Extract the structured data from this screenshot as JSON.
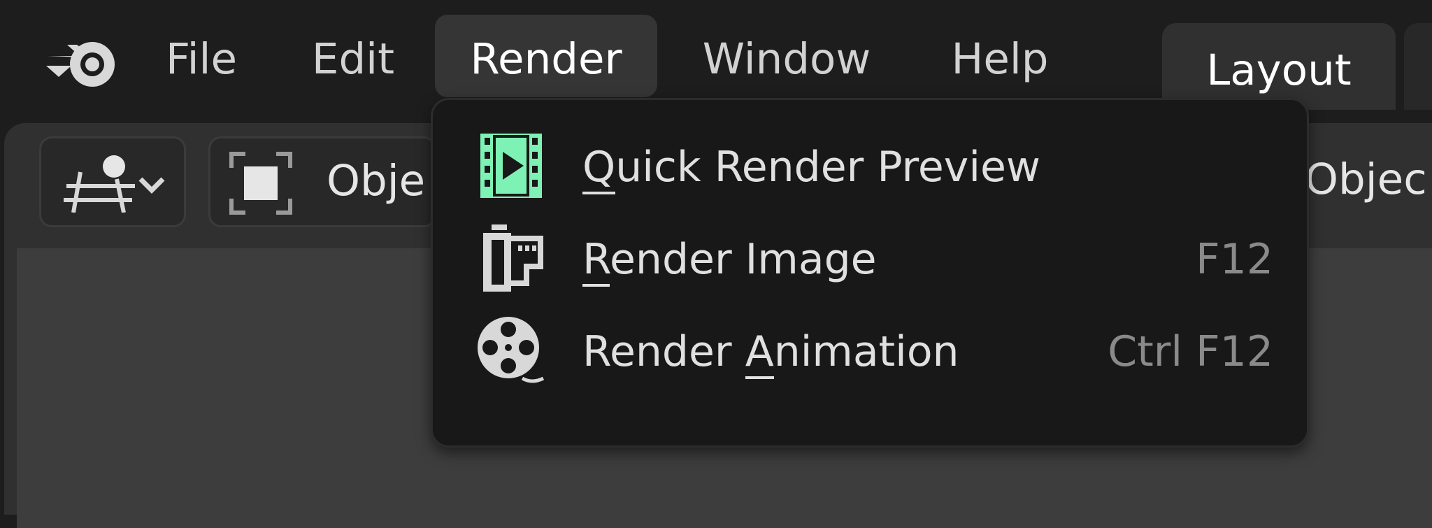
{
  "menu": {
    "logo_icon": "blender-logo-icon",
    "items": [
      {
        "label": "File"
      },
      {
        "label": "Edit"
      },
      {
        "label": "Render",
        "active": true
      },
      {
        "label": "Window"
      },
      {
        "label": "Help"
      }
    ]
  },
  "workspace_tabs": [
    {
      "label": "Layout"
    }
  ],
  "header": {
    "editor_type_icon": "scene-editor-icon",
    "mode_icon": "object-mode-icon",
    "mode_label": "Obje",
    "right_label": "Objec"
  },
  "render_menu": {
    "items": [
      {
        "pre": "",
        "ul": "Q",
        "post": "uick Render Preview",
        "shortcut": "",
        "icon": "render-preview-icon",
        "icon_color": "#7ef2b4"
      },
      {
        "pre": "",
        "ul": "R",
        "post": "ender Image",
        "shortcut": "F12",
        "icon": "render-still-icon"
      },
      {
        "pre": "Render ",
        "ul": "A",
        "post": "nimation",
        "shortcut": "Ctrl F12",
        "icon": "render-animation-icon"
      }
    ]
  }
}
